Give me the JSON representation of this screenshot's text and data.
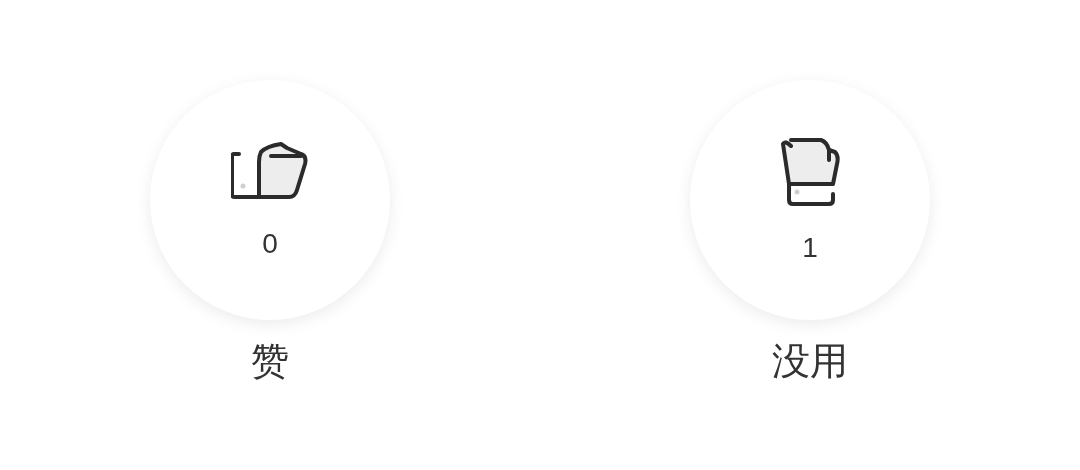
{
  "reactions": [
    {
      "kind": "like",
      "count": "0",
      "label": "赞"
    },
    {
      "kind": "useless",
      "count": "1",
      "label": "没用"
    }
  ]
}
